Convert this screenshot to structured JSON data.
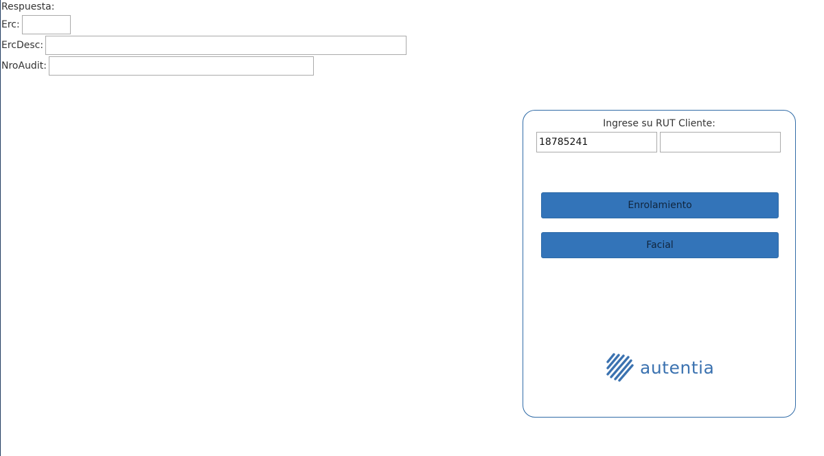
{
  "response": {
    "title": "Respuesta:",
    "fields": {
      "erc": {
        "label": "Erc:",
        "value": ""
      },
      "ercdesc": {
        "label": "ErcDesc:",
        "value": ""
      },
      "nroaudit": {
        "label": "NroAudit:",
        "value": ""
      }
    }
  },
  "panel": {
    "rut_label": "Ingrese su RUT Cliente:",
    "rut_value": "18785241",
    "rut_dv_value": "",
    "buttons": {
      "enrolamiento": "Enrolamiento",
      "facial": "Facial"
    },
    "logo": {
      "text": "autentia",
      "icon": "autentia-stripes-icon"
    },
    "colors": {
      "accent": "#3374b9",
      "border": "#2e6aa6",
      "logo": "#3b72b0"
    }
  }
}
